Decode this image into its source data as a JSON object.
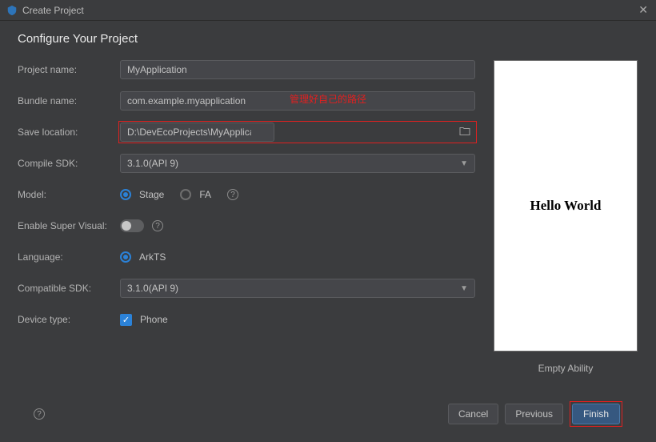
{
  "window": {
    "title": "Create Project"
  },
  "heading": "Configure Your Project",
  "labels": {
    "projectName": "Project name:",
    "bundleName": "Bundle name:",
    "saveLocation": "Save location:",
    "compileSdk": "Compile SDK:",
    "model": "Model:",
    "enableSuperVisual": "Enable Super Visual:",
    "language": "Language:",
    "compatibleSdk": "Compatible SDK:",
    "deviceType": "Device type:"
  },
  "fields": {
    "projectName": "MyApplication",
    "bundleName": "com.example.myapplication",
    "saveLocation": "D:\\DevEcoProjects\\MyApplication",
    "compileSdk": "3.1.0(API 9)",
    "modelStage": "Stage",
    "modelFA": "FA",
    "language": "ArkTS",
    "compatibleSdk": "3.1.0(API 9)",
    "deviceTypePhone": "Phone"
  },
  "modelSelected": "Stage",
  "annotation": "管理好自己的路径",
  "preview": {
    "text": "Hello World",
    "caption": "Empty Ability"
  },
  "footer": {
    "cancel": "Cancel",
    "previous": "Previous",
    "finish": "Finish"
  }
}
